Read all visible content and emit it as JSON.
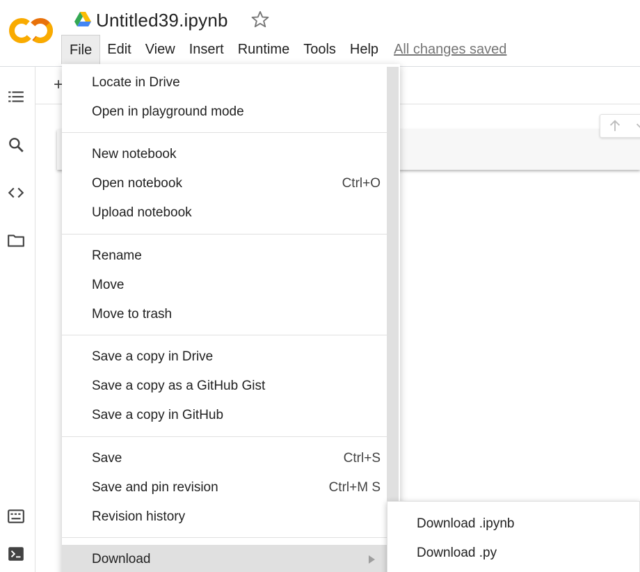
{
  "header": {
    "title": "Untitled39.ipynb",
    "saved_status": "All changes saved",
    "logo_icon": "colab-logo-icon",
    "brand_colors": {
      "orange": "#F9AB00",
      "dark_orange": "#E8710A"
    }
  },
  "menubar": {
    "items": [
      {
        "label": "File"
      },
      {
        "label": "Edit"
      },
      {
        "label": "View"
      },
      {
        "label": "Insert"
      },
      {
        "label": "Runtime"
      },
      {
        "label": "Tools"
      },
      {
        "label": "Help"
      }
    ],
    "active": "File"
  },
  "toolbar": {
    "add_label": "+"
  },
  "file_menu": {
    "groups": [
      [
        {
          "label": "Locate in Drive",
          "shortcut": ""
        },
        {
          "label": "Open in playground mode",
          "shortcut": ""
        }
      ],
      [
        {
          "label": "New notebook",
          "shortcut": ""
        },
        {
          "label": "Open notebook",
          "shortcut": "Ctrl+O"
        },
        {
          "label": "Upload notebook",
          "shortcut": ""
        }
      ],
      [
        {
          "label": "Rename",
          "shortcut": ""
        },
        {
          "label": "Move",
          "shortcut": ""
        },
        {
          "label": "Move to trash",
          "shortcut": ""
        }
      ],
      [
        {
          "label": "Save a copy in Drive",
          "shortcut": ""
        },
        {
          "label": "Save a copy as a GitHub Gist",
          "shortcut": ""
        },
        {
          "label": "Save a copy in GitHub",
          "shortcut": ""
        }
      ],
      [
        {
          "label": "Save",
          "shortcut": "Ctrl+S"
        },
        {
          "label": "Save and pin revision",
          "shortcut": "Ctrl+M S"
        },
        {
          "label": "Revision history",
          "shortcut": ""
        }
      ],
      [
        {
          "label": "Download",
          "shortcut": "",
          "submenu": true,
          "highlighted": true
        }
      ]
    ]
  },
  "download_submenu": {
    "items": [
      {
        "label": "Download .ipynb"
      },
      {
        "label": "Download .py"
      }
    ]
  },
  "rail": {
    "icons": [
      "table-of-contents-icon",
      "search-icon",
      "code-snippets-icon",
      "files-folder-icon",
      "command-palette-icon",
      "terminal-icon"
    ]
  }
}
